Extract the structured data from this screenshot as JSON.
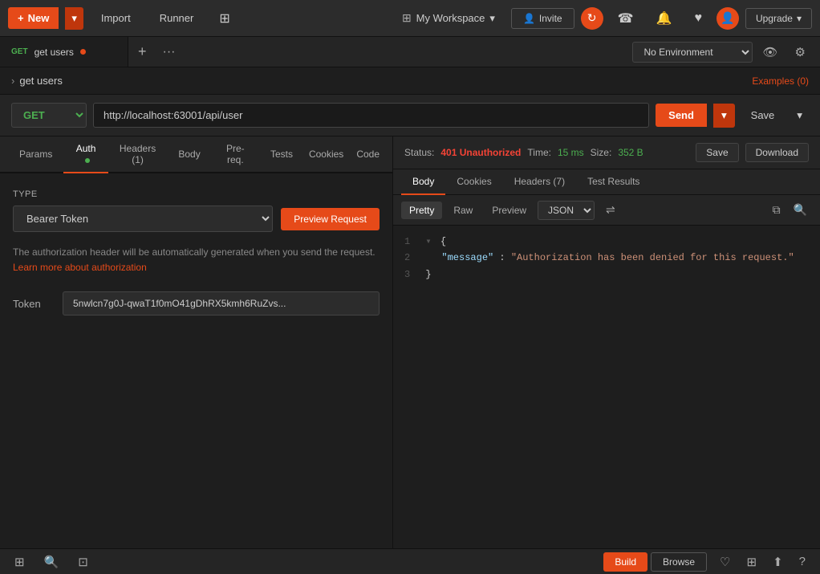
{
  "topnav": {
    "new_label": "New",
    "import_label": "Import",
    "runner_label": "Runner",
    "workspace_label": "My Workspace",
    "invite_label": "Invite",
    "upgrade_label": "Upgrade"
  },
  "tabs": {
    "tab1_method": "GET",
    "tab1_name": "get users",
    "add_icon": "+",
    "more_icon": "···"
  },
  "env": {
    "placeholder": "No Environment"
  },
  "breadcrumb": {
    "text": "get users",
    "examples_label": "Examples (0)"
  },
  "urlbar": {
    "method": "GET",
    "url": "http://localhost:63001/api/user",
    "send_label": "Send",
    "save_label": "Save"
  },
  "request_tabs": {
    "params": "Params",
    "auth": "Auth",
    "headers": "Headers (1)",
    "body": "Body",
    "prereq": "Pre-req.",
    "tests": "Tests",
    "cookies": "Cookies",
    "code": "Code"
  },
  "auth": {
    "type_label": "TYPE",
    "bearer_token": "Bearer Token",
    "preview_request": "Preview Request",
    "info_text": "The authorization header will be automatically generated when you send the request.",
    "learn_link": "Learn more about authorization",
    "token_label": "Token",
    "token_value": "5nwlcn7g0J-qwaT1f0mO41gDhRX5kmh6RuZvs..."
  },
  "response": {
    "status_label": "Status:",
    "status_value": "401 Unauthorized",
    "time_label": "Time:",
    "time_value": "15 ms",
    "size_label": "Size:",
    "size_value": "352 B",
    "save_label": "Save",
    "download_label": "Download"
  },
  "response_tabs": {
    "body": "Body",
    "cookies": "Cookies",
    "headers": "Headers (7)",
    "test_results": "Test Results"
  },
  "resp_toolbar": {
    "pretty": "Pretty",
    "raw": "Raw",
    "preview": "Preview",
    "format": "JSON"
  },
  "json_content": {
    "line1": "{",
    "line2": "  \"message\": \"Authorization has been denied for this request.\"",
    "line3": "}"
  },
  "bottom_bar": {
    "build_label": "Build",
    "browse_label": "Browse"
  }
}
